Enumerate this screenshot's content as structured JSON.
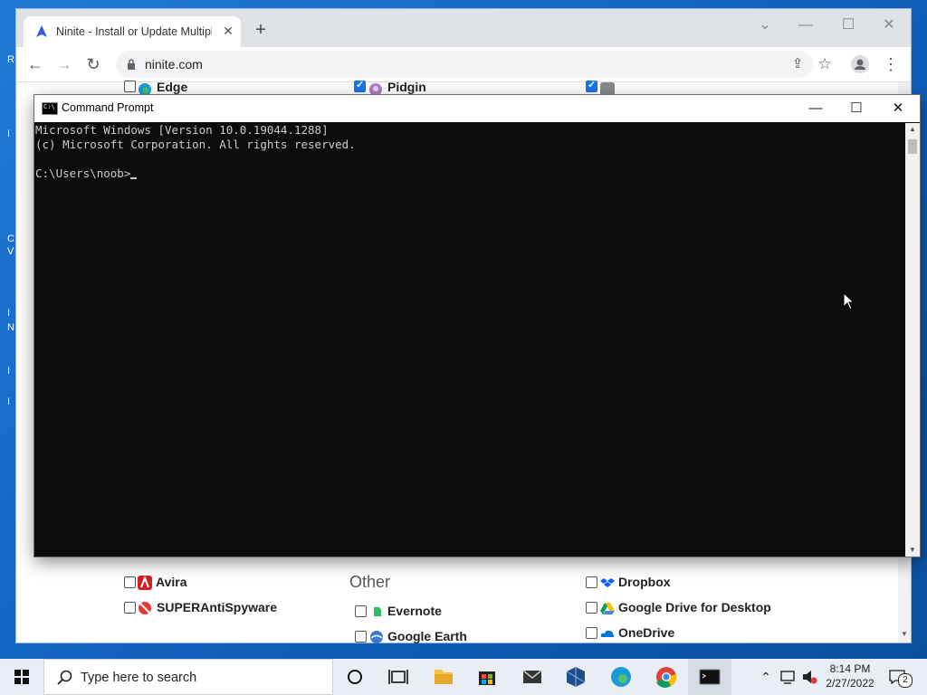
{
  "desktop": {
    "fragments": [
      "R",
      "I",
      "C",
      "V",
      "I",
      "N",
      "I",
      "I"
    ]
  },
  "browser": {
    "tab_title": "Ninite - Install or Update Multipl",
    "url": "ninite.com",
    "controls": {
      "minimize": "—",
      "maximize": "☐",
      "close": "✕",
      "tablist": "⌄"
    },
    "apps_top": [
      {
        "label": "Edge",
        "checked": false
      },
      {
        "label": "Pidgin",
        "checked": true
      }
    ],
    "section_other": "Other",
    "apps_bottom_left": [
      {
        "label": "Avira",
        "checked": false
      },
      {
        "label": "SUPERAntiSpyware",
        "checked": false
      }
    ],
    "apps_other": [
      {
        "label": "Evernote",
        "checked": false
      },
      {
        "label": "Google Earth",
        "checked": false
      }
    ],
    "apps_right": [
      {
        "label": "Dropbox",
        "checked": false
      },
      {
        "label": "Google Drive for Desktop",
        "checked": false
      },
      {
        "label": "OneDrive",
        "checked": false
      }
    ]
  },
  "cmd": {
    "title": "Command Prompt",
    "lines": [
      "Microsoft Windows [Version 10.0.19044.1288]",
      "(c) Microsoft Corporation. All rights reserved.",
      "",
      "C:\\Users\\noob>"
    ],
    "controls": {
      "minimize": "—",
      "maximize": "☐",
      "close": "✕"
    }
  },
  "taskbar": {
    "search_placeholder": "Type here to search",
    "time": "8:14 PM",
    "date": "2/27/2022",
    "notification_count": "2"
  },
  "colors": {
    "desktop": "#1a6fc4",
    "chrome_tabstrip": "#dee1e6",
    "console_bg": "#0c0c0c",
    "console_text": "#cccccc",
    "checkbox_checked": "#1a73e8"
  }
}
